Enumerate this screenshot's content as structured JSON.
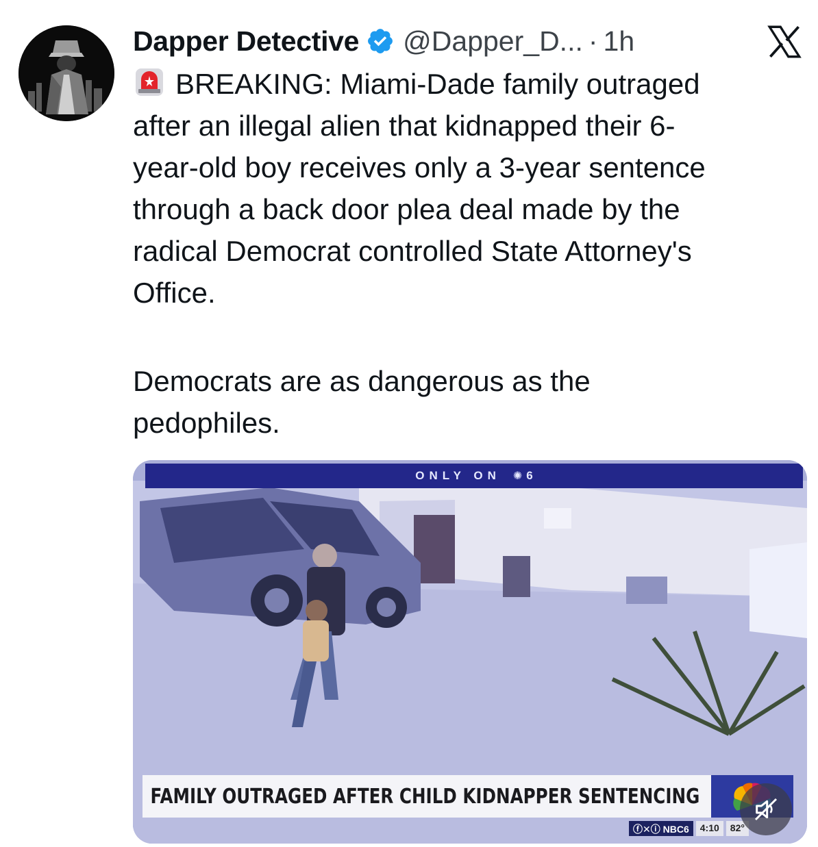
{
  "author": {
    "display_name": "Dapper Detective",
    "handle": "@Dapper_D...",
    "separator": "·",
    "time": "1h",
    "verified": true,
    "avatar_icon": "detective-silhouette-avatar"
  },
  "platform": {
    "logo_icon": "x-logo-icon"
  },
  "tweet": {
    "emoji_icon": "rotating-light-siren",
    "text": "BREAKING: Miami-Dade family outraged\nafter an illegal alien that kidnapped their 6-\nyear-old boy receives only a 3-year sentence\nthrough a back door plea deal made by the\nradical Democrat controlled State Attorney's\nOffice.",
    "text_line2": "Democrats are as dangerous as the\npedophiles."
  },
  "media": {
    "top_banner": "ONLY ON",
    "top_banner_channel": "6",
    "headline": "FAMILY OUTRAGED AFTER CHILD KIDNAPPER SENTENCING",
    "social_strip": "NBC6",
    "clock": "4:10",
    "temperature": "82°",
    "mute_icon": "muted-speaker-icon"
  },
  "colors": {
    "verified_blue": "#1d9bf0",
    "banner_navy": "#23278a",
    "text": "#0f1419",
    "secondary_text": "#3d4349"
  }
}
